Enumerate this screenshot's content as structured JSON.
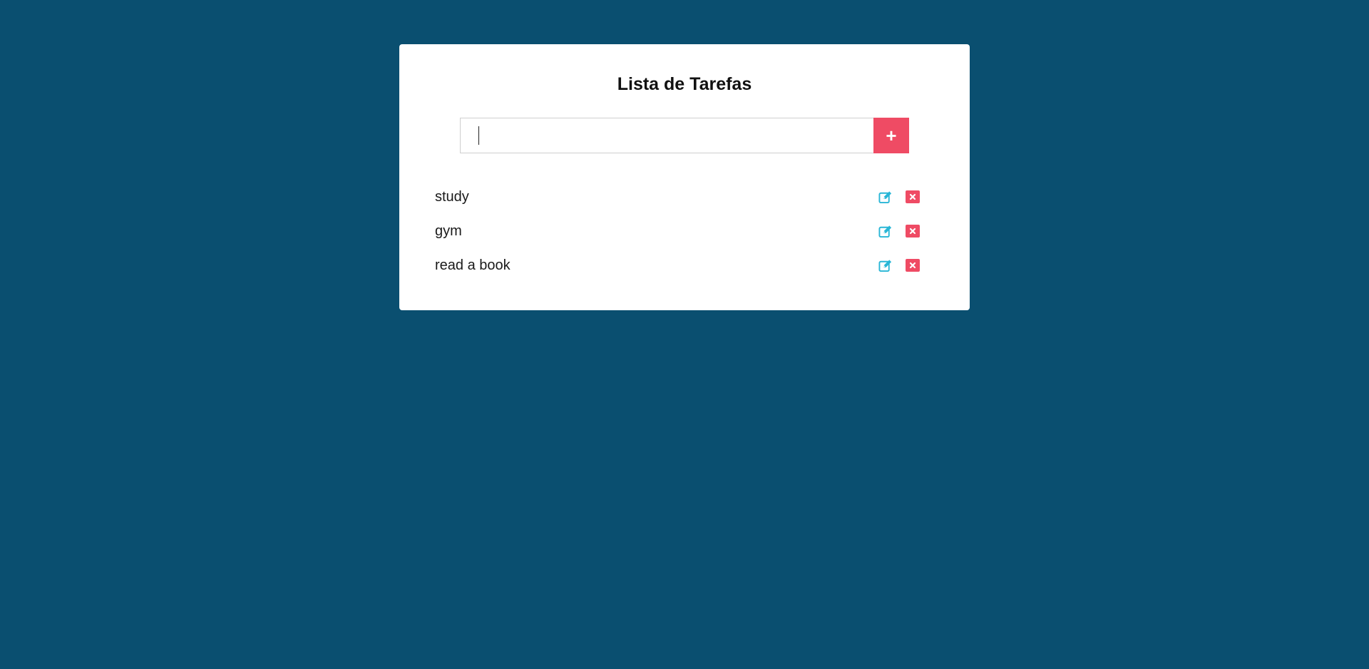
{
  "app": {
    "title": "Lista de Tarefas"
  },
  "form": {
    "input_value": "",
    "input_placeholder": "",
    "add_label": "+"
  },
  "tasks": [
    {
      "text": "study"
    },
    {
      "text": "gym"
    },
    {
      "text": "read a book"
    }
  ],
  "icons": {
    "edit": "edit-icon",
    "delete": "delete-icon"
  },
  "colors": {
    "background": "#0a4f70",
    "accent": "#ef4b64",
    "edit": "#29b6d6"
  }
}
